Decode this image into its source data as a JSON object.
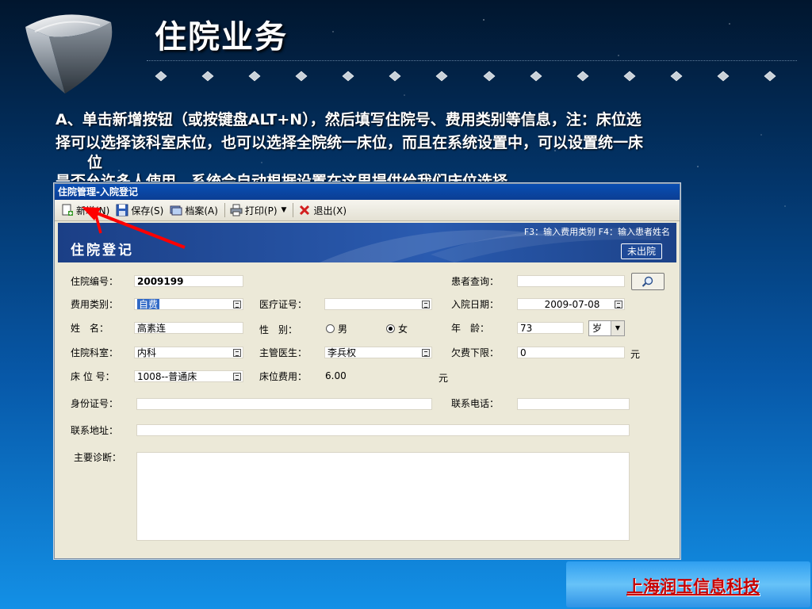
{
  "slide": {
    "title": "住院业务",
    "body_lines": [
      {
        "prefix": "A",
        "text": "、单击新增按钮（或按键盘",
        "key": "ALT+N",
        "rest": "），然后填写住院号、费用类别等信息，注：床位选"
      },
      {
        "text": "择可以选择该科室床位，也可以选择全院统一床位，而且在系统设置中，可以设置统一床"
      },
      {
        "text": "位"
      },
      {
        "text": "是否允许多人使用，系统会自动根据设置在这里提供给我们床位选择。"
      }
    ]
  },
  "window": {
    "title": "住院管理-入院登记",
    "toolbar": {
      "new_label": "新增(N)",
      "save_label": "保存(S)",
      "archive_label": "档案(A)",
      "print_label": "打印(P)",
      "exit_label": "退出(X)"
    },
    "banner": {
      "hint": "F3：输入费用类别 F4：输入患者姓名",
      "title": "住院登记",
      "status": "未出院"
    },
    "form": {
      "admission_no_label": "住院编号：",
      "admission_no": "2009199",
      "patient_search_label": "患者查询：",
      "patient_search": "",
      "fee_type_label": "费用类别：",
      "fee_type": "自费",
      "medical_card_label": "医疗证号：",
      "medical_card": "",
      "admit_date_label": "入院日期：",
      "admit_date": "2009-07-08",
      "name_label": "姓　名：",
      "name": "高素连",
      "gender_label": "性　别：",
      "gender_male": "男",
      "gender_female": "女",
      "gender_selected": "女",
      "age_label": "年　龄：",
      "age": "73",
      "age_unit": "岁",
      "department_label": "住院科室：",
      "department": "内科",
      "doctor_label": "主管医生：",
      "doctor": "李兵权",
      "arrears_label": "欠费下限：",
      "arrears": "0",
      "arrears_unit": "元",
      "bed_label": "床 位 号：",
      "bed": "1008--普通床",
      "bed_fee_label": "床位费用：",
      "bed_fee": "6.00",
      "bed_fee_unit": "元",
      "id_card_label": "身份证号：",
      "id_card": "",
      "phone_label": "联系电话：",
      "phone": "",
      "address_label": "联系地址：",
      "address": "",
      "diagnosis_label": "主要诊断：",
      "diagnosis": ""
    }
  },
  "footer": {
    "company": "上海润玉信息科技"
  },
  "colors": {
    "banner": "#2a5bb0",
    "window_bg": "#ece9d8",
    "titlebar": "#0a4fb3",
    "company_text": "#c80000",
    "arrow": "#ff0000"
  }
}
